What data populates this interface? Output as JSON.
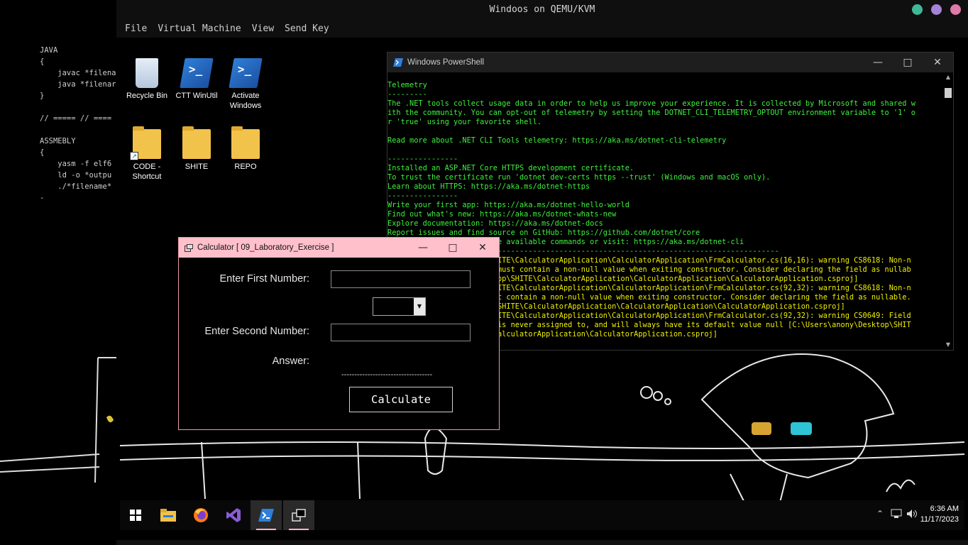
{
  "host": {
    "editor_text": "JAVA\n{\n    javac *filena\n    java *filenar\n}\n\n// ===== // ====\n\nASSMEBLY\n{\n    yasm -f elf6\n    ld -o *outpu\n    ./*filename*\n-"
  },
  "qemu": {
    "title": "Windoos on QEMU/KVM",
    "menu": [
      "File",
      "Virtual Machine",
      "View",
      "Send Key"
    ],
    "dots": [
      "#3fb89a",
      "#a583d8",
      "#e07aa8"
    ]
  },
  "desktop": {
    "icons": [
      {
        "label": "Recycle Bin",
        "icon": "recycle-bin-icon"
      },
      {
        "label": "CTT WinUtil",
        "icon": "powershell-icon"
      },
      {
        "label": "Activate Windows",
        "icon": "powershell-icon"
      },
      {
        "label": "CODE - Shortcut",
        "icon": "folder-icon"
      },
      {
        "label": "SHITE",
        "icon": "folder-icon"
      },
      {
        "label": "REPO",
        "icon": "folder-icon"
      }
    ]
  },
  "powershell": {
    "title": "Windows PowerShell",
    "lines": [
      {
        "text": "Telemetry",
        "color": "green"
      },
      {
        "text": "---------",
        "color": "green"
      },
      {
        "text": "The .NET tools collect usage data in order to help us improve your experience. It is collected by Microsoft and shared w",
        "color": "green"
      },
      {
        "text": "ith the community. You can opt-out of telemetry by setting the DOTNET_CLI_TELEMETRY_OPTOUT environment variable to '1' o",
        "color": "green"
      },
      {
        "text": "r 'true' using your favorite shell.",
        "color": "green"
      },
      {
        "text": "",
        "color": "green"
      },
      {
        "text": "Read more about .NET CLI Tools telemetry: https://aka.ms/dotnet-cli-telemetry",
        "color": "green"
      },
      {
        "text": "",
        "color": "green"
      },
      {
        "text": "----------------",
        "color": "green"
      },
      {
        "text": "Installed an ASP.NET Core HTTPS development certificate.",
        "color": "green"
      },
      {
        "text": "To trust the certificate run 'dotnet dev-certs https --trust' (Windows and macOS only).",
        "color": "green"
      },
      {
        "text": "Learn about HTTPS: https://aka.ms/dotnet-https",
        "color": "green"
      },
      {
        "text": "----------------",
        "color": "green"
      },
      {
        "text": "Write your first app: https://aka.ms/dotnet-hello-world",
        "color": "green"
      },
      {
        "text": "Find out what's new: https://aka.ms/dotnet-whats-new",
        "color": "green"
      },
      {
        "text": "Explore documentation: https://aka.ms/dotnet-docs",
        "color": "green"
      },
      {
        "text": "Report issues and find source on GitHub: https://github.com/dotnet/core",
        "color": "green"
      },
      {
        "text": "                        ee available commands or visit: https://aka.ms/dotnet-cli",
        "color": "green"
      },
      {
        "text": "                        -----------------------------------------------------------------",
        "color": "green"
      },
      {
        "text": "                        HITE\\CalculatorApplication\\CalculatorApplication\\FrmCalculator.cs(16,16): warning CS8618: Non-n",
        "color": "yellow"
      },
      {
        "text": "                         must contain a non-null value when exiting constructor. Consider declaring the field as nullab",
        "color": "yellow"
      },
      {
        "text": "                        top\\SHITE\\CalculatorApplication\\CalculatorApplication\\CalculatorApplication.csproj]",
        "color": "yellow"
      },
      {
        "text": "                        HITE\\CalculatorApplication\\CalculatorApplication\\FrmCalculator.cs(92,32): warning CS8618: Non-n",
        "color": "yellow"
      },
      {
        "text": "                        st contain a non-null value when exiting constructor. Consider declaring the field as nullable.",
        "color": "yellow"
      },
      {
        "text": "                        \\SHITE\\CalculatorApplication\\CalculatorApplication\\CalculatorApplication.csproj]",
        "color": "yellow"
      },
      {
        "text": "                        HITE\\CalculatorApplication\\CalculatorApplication\\FrmCalculator.cs(92,32): warning CS0649: Field",
        "color": "yellow"
      },
      {
        "text": "                         is never assigned to, and will always have its default value null [C:\\Users\\anony\\Desktop\\SHIT",
        "color": "yellow"
      },
      {
        "text": "                        CalculatorApplication\\CalculatorApplication.csproj]",
        "color": "yellow"
      }
    ]
  },
  "calculator": {
    "title": "Calculator [ 09_Laboratory_Exercise ]",
    "first_label": "Enter First Number:",
    "first_value": "",
    "second_label": "Enter Second Number:",
    "second_value": "",
    "operator_value": "",
    "answer_label": "Answer:",
    "answer_value": "-----------------------------------",
    "button_label": "Calculate"
  },
  "taskbar": {
    "apps": [
      "start-icon",
      "file-explorer-icon",
      "firefox-icon",
      "visual-studio-icon",
      "powershell-icon",
      "app-window-icon"
    ],
    "time": "6:36 AM",
    "date": "11/17/2023"
  }
}
